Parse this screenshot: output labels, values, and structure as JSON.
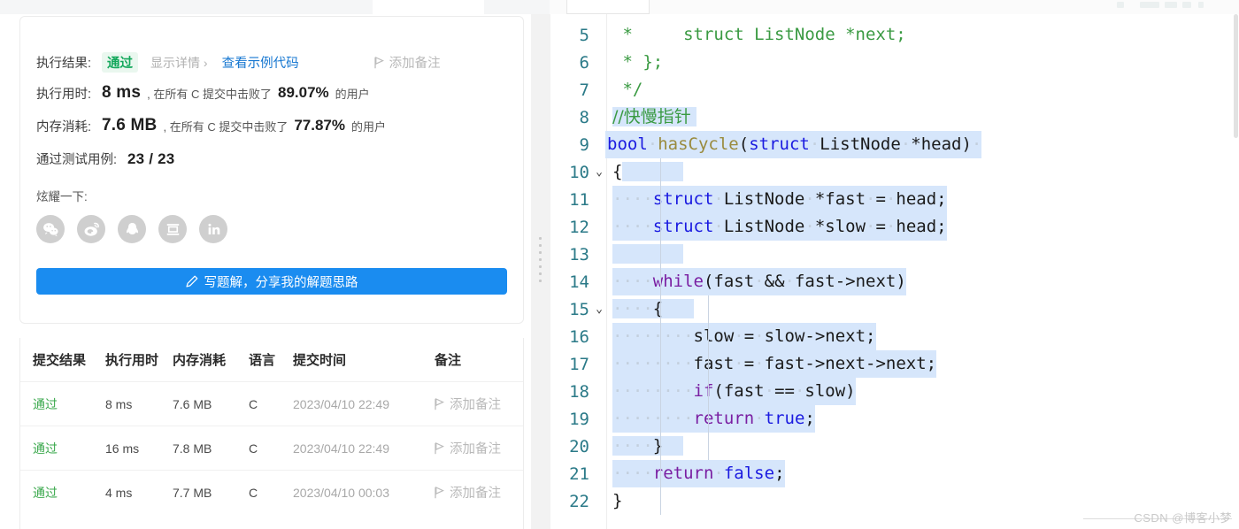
{
  "result_panel": {
    "exec_result_label": "执行结果:",
    "status": "通过",
    "show_detail": "显示详情 ›",
    "sample_code": "查看示例代码",
    "add_note": "添加备注",
    "runtime_label": "执行用时:",
    "runtime_value": "8 ms",
    "runtime_desc_prefix": ", 在所有 C 提交中击败了",
    "runtime_percent": "89.07%",
    "runtime_desc_suffix": "的用户",
    "memory_label": "内存消耗:",
    "memory_value": "7.6 MB",
    "memory_desc_prefix": ", 在所有 C 提交中击败了",
    "memory_percent": "77.87%",
    "memory_desc_suffix": "的用户",
    "testcases_label": "通过测试用例:",
    "testcases_value": "23 / 23",
    "share_label": "炫耀一下:",
    "share_icons": [
      "wechat-icon",
      "weibo-icon",
      "qq-icon",
      "douban-icon",
      "linkedin-icon"
    ],
    "solve_button": "写题解，分享我的解题思路",
    "solve_button_icon": "pencil-icon",
    "accent_blue": "#1a8cf0",
    "pass_green": "#14a85c"
  },
  "submissions": {
    "columns": [
      "提交结果",
      "执行用时",
      "内存消耗",
      "语言",
      "提交时间",
      "备注"
    ],
    "rows": [
      {
        "result": "通过",
        "runtime": "8 ms",
        "memory": "7.6 MB",
        "lang": "C",
        "time": "2023/04/10 22:49",
        "note": "添加备注"
      },
      {
        "result": "通过",
        "runtime": "16 ms",
        "memory": "7.8 MB",
        "lang": "C",
        "time": "2023/04/10 22:49",
        "note": "添加备注"
      },
      {
        "result": "通过",
        "runtime": "4 ms",
        "memory": "7.7 MB",
        "lang": "C",
        "time": "2023/04/10 00:03",
        "note": "添加备注"
      }
    ]
  },
  "editor": {
    "first_line": 5,
    "lines": [
      {
        "n": "5",
        "fold": "",
        "selected": false
      },
      {
        "n": "6",
        "fold": "",
        "selected": false
      },
      {
        "n": "7",
        "fold": "",
        "selected": false
      },
      {
        "n": "8",
        "fold": "",
        "selected": true
      },
      {
        "n": "9",
        "fold": "",
        "selected": true
      },
      {
        "n": "10",
        "fold": "⌄",
        "selected": true
      },
      {
        "n": "11",
        "fold": "",
        "selected": true
      },
      {
        "n": "12",
        "fold": "",
        "selected": true
      },
      {
        "n": "13",
        "fold": "",
        "selected": true
      },
      {
        "n": "14",
        "fold": "",
        "selected": true
      },
      {
        "n": "15",
        "fold": "⌄",
        "selected": true
      },
      {
        "n": "16",
        "fold": "",
        "selected": true
      },
      {
        "n": "17",
        "fold": "",
        "selected": true
      },
      {
        "n": "18",
        "fold": "",
        "selected": true
      },
      {
        "n": "19",
        "fold": "",
        "selected": true
      },
      {
        "n": "20",
        "fold": "",
        "selected": true
      },
      {
        "n": "21",
        "fold": "",
        "selected": true
      },
      {
        "n": "22",
        "fold": "",
        "selected": false
      }
    ],
    "code_text": [
      " *     struct ListNode *next;",
      " * };",
      " */",
      "//快慢指针",
      "bool hasCycle(struct ListNode *head) ",
      "{",
      "    struct ListNode *fast = head;",
      "    struct ListNode *slow = head;",
      "",
      "    while(fast && fast->next)",
      "    {",
      "        slow = slow->next;",
      "        fast = fast->next->next;",
      "        if(fast == slow)",
      "            return true;",
      "    }",
      "    return false;",
      "}"
    ]
  },
  "watermark": "CSDN @博客小梦"
}
